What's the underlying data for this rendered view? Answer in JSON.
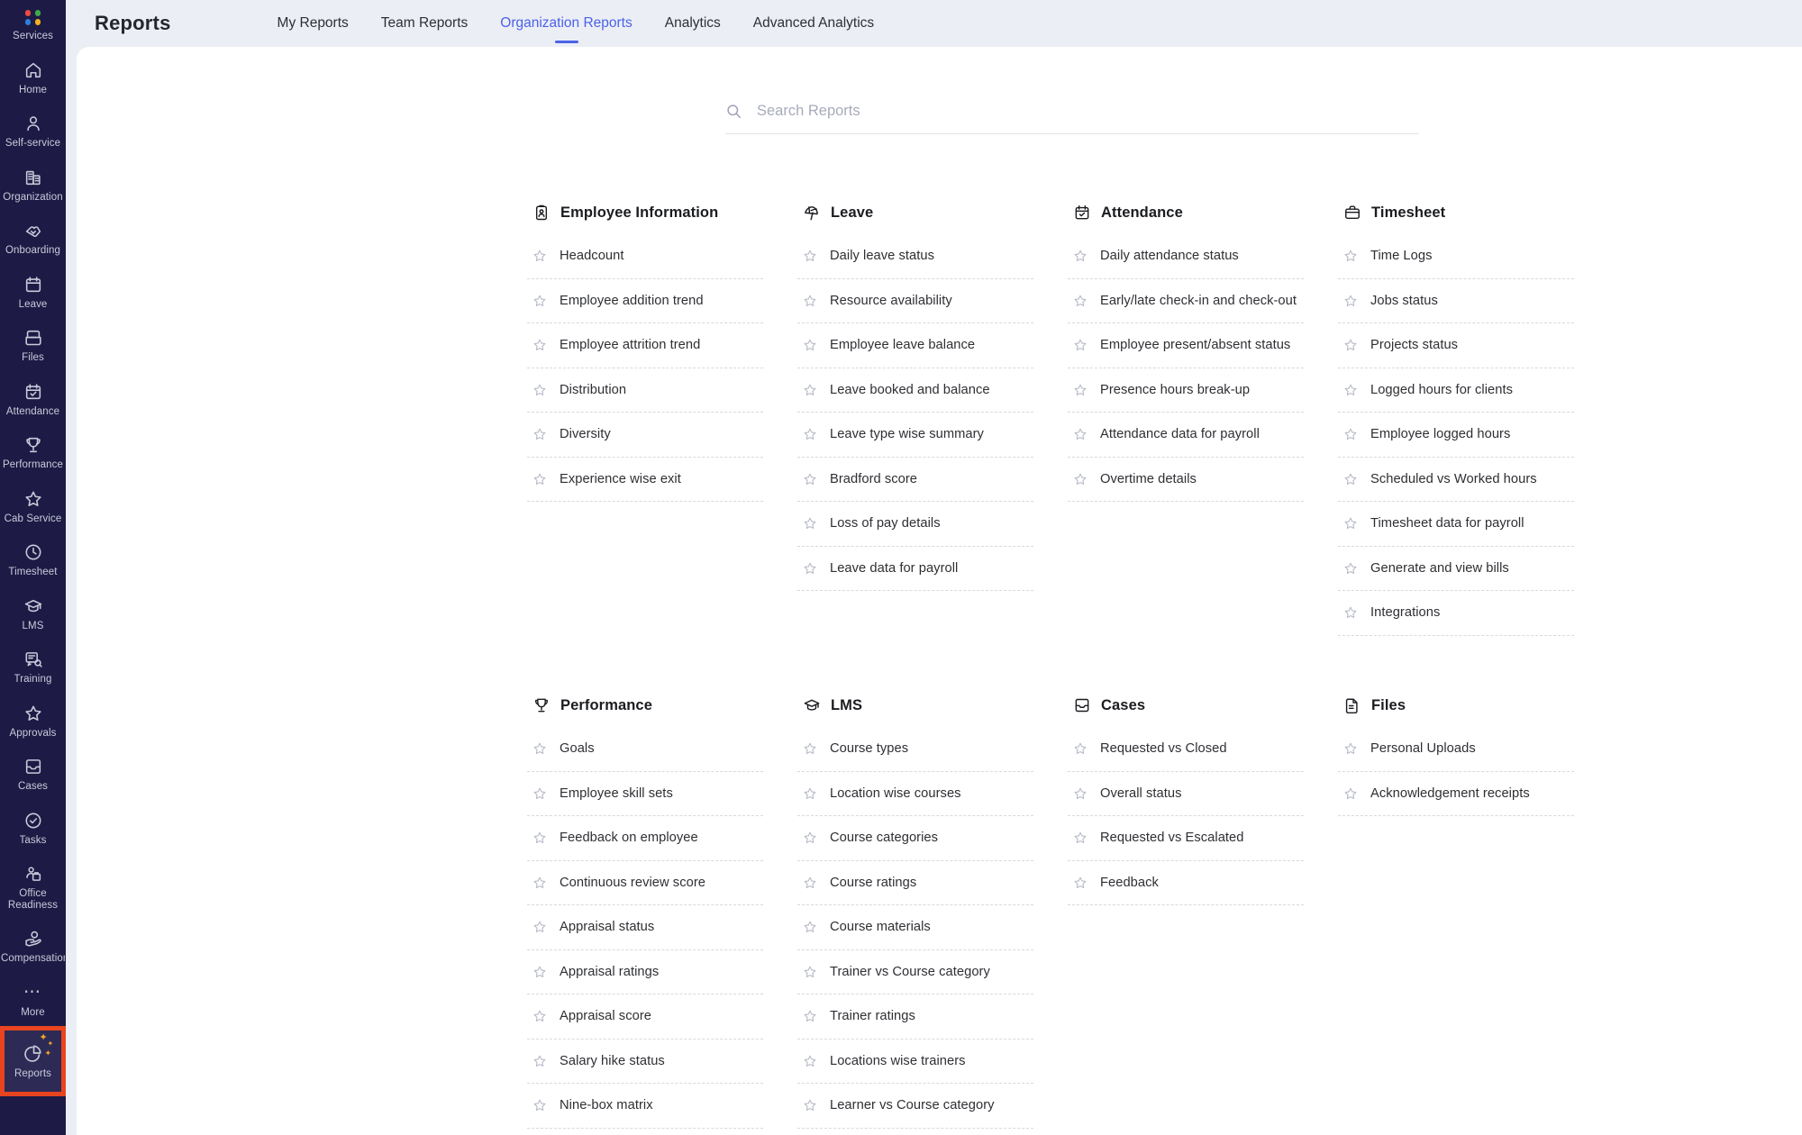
{
  "sidebar": {
    "items": [
      {
        "label": "Services",
        "icon": "services-dots-icon"
      },
      {
        "label": "Home",
        "icon": "home-icon"
      },
      {
        "label": "Self-service",
        "icon": "user-icon"
      },
      {
        "label": "Organization",
        "icon": "buildings-icon"
      },
      {
        "label": "Onboarding",
        "icon": "handshake-heart-icon"
      },
      {
        "label": "Leave",
        "icon": "calendar-icon"
      },
      {
        "label": "Files",
        "icon": "files-icon"
      },
      {
        "label": "Attendance",
        "icon": "calendar-check-icon"
      },
      {
        "label": "Performance",
        "icon": "trophy-icon"
      },
      {
        "label": "Cab Service",
        "icon": "star-icon"
      },
      {
        "label": "Timesheet",
        "icon": "clock-icon"
      },
      {
        "label": "LMS",
        "icon": "graduation-cap-icon"
      },
      {
        "label": "Training",
        "icon": "training-icon"
      },
      {
        "label": "Approvals",
        "icon": "star-icon"
      },
      {
        "label": "Cases",
        "icon": "inbox-icon"
      },
      {
        "label": "Tasks",
        "icon": "check-circle-icon"
      },
      {
        "label": "Office Readiness",
        "icon": "office-readiness-icon"
      },
      {
        "label": "Compensation",
        "icon": "hand-coin-icon"
      },
      {
        "label": "More",
        "icon": "ellipsis-icon"
      },
      {
        "label": "Reports",
        "icon": "pie-chart-icon"
      }
    ],
    "active_label": "Reports",
    "highlight_color": "#e8441f",
    "background_color": "#1d1b45"
  },
  "header": {
    "title": "Reports",
    "tabs": [
      {
        "label": "My Reports",
        "active": false
      },
      {
        "label": "Team Reports",
        "active": false
      },
      {
        "label": "Organization Reports",
        "active": true
      },
      {
        "label": "Analytics",
        "active": false
      },
      {
        "label": "Advanced Analytics",
        "active": false
      }
    ],
    "active_tab_color": "#4a62e8"
  },
  "search": {
    "placeholder": "Search Reports",
    "value": "",
    "icon": "search-icon"
  },
  "sections": [
    {
      "title": "Employee Information",
      "icon": "clipboard-user-icon",
      "items": [
        "Headcount",
        "Employee addition trend",
        "Employee attrition trend",
        "Distribution",
        "Diversity",
        "Experience wise exit"
      ]
    },
    {
      "title": "Leave",
      "icon": "beach-umbrella-icon",
      "items": [
        "Daily leave status",
        "Resource availability",
        "Employee leave balance",
        "Leave booked and balance",
        "Leave type wise summary",
        "Bradford score",
        "Loss of pay details",
        "Leave data for payroll"
      ]
    },
    {
      "title": "Attendance",
      "icon": "calendar-check-icon",
      "items": [
        "Daily attendance status",
        "Early/late check-in and check-out",
        "Employee present/absent status",
        "Presence hours break-up",
        "Attendance data for payroll",
        "Overtime details"
      ]
    },
    {
      "title": "Timesheet",
      "icon": "briefcase-icon",
      "items": [
        "Time Logs",
        "Jobs status",
        "Projects status",
        "Logged hours for clients",
        "Employee logged hours",
        "Scheduled vs Worked hours",
        "Timesheet data for payroll",
        "Generate and view bills",
        "Integrations"
      ]
    },
    {
      "title": "Performance",
      "icon": "trophy-icon",
      "items": [
        "Goals",
        "Employee skill sets",
        "Feedback on employee",
        "Continuous review score",
        "Appraisal status",
        "Appraisal ratings",
        "Appraisal score",
        "Salary hike status",
        "Nine-box matrix"
      ]
    },
    {
      "title": "LMS",
      "icon": "graduation-cap-icon",
      "items": [
        "Course types",
        "Location wise courses",
        "Course categories",
        "Course ratings",
        "Course materials",
        "Trainer vs Course category",
        "Trainer ratings",
        "Locations wise trainers",
        "Learner vs Course category"
      ]
    },
    {
      "title": "Cases",
      "icon": "inbox-icon",
      "items": [
        "Requested vs Closed",
        "Overall status",
        "Requested vs Escalated",
        "Feedback"
      ]
    },
    {
      "title": "Files",
      "icon": "document-icon",
      "items": [
        "Personal Uploads",
        "Acknowledgement receipts"
      ]
    }
  ]
}
